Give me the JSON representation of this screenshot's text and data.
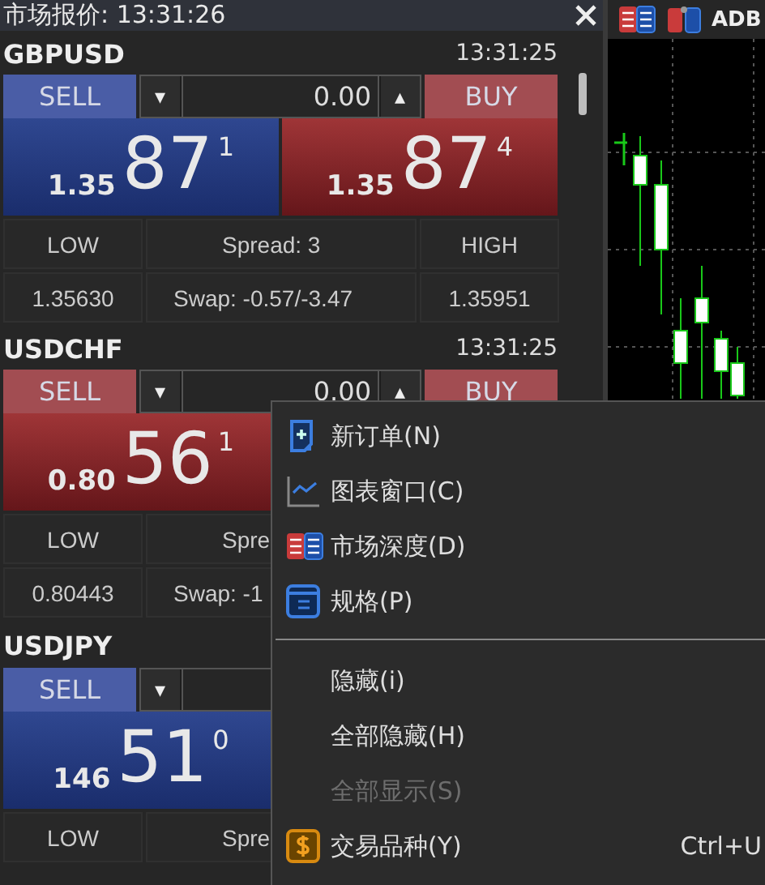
{
  "window": {
    "title": "市场报价: 13:31:26"
  },
  "symbols": [
    {
      "name": "GBPUSD",
      "time": "13:31:25",
      "sell": {
        "label": "SELL",
        "rising": true,
        "prefix": "1.35",
        "big": "87",
        "sup": "1"
      },
      "lot": {
        "down": "▾",
        "value": "0.00",
        "up": "▴"
      },
      "buy": {
        "label": "BUY",
        "rising": false,
        "prefix": "1.35",
        "big": "87",
        "sup": "4"
      },
      "stats": {
        "low_label": "LOW",
        "spread": "Spread: 3",
        "high_label": "HIGH",
        "low": "1.35630",
        "swap": "Swap: -0.57/-3.47",
        "high": "1.35951"
      }
    },
    {
      "name": "USDCHF",
      "time": "13:31:25",
      "sell": {
        "label": "SELL",
        "rising": false,
        "prefix": "0.80",
        "big": "56",
        "sup": "1"
      },
      "lot": {
        "down": "▾",
        "value": "0.00",
        "up": "▴"
      },
      "buy": {
        "label": "BUY",
        "rising": false
      },
      "stats": {
        "low_label": "LOW",
        "spread": "Spre",
        "low": "0.80443",
        "swap": "Swap: -1"
      }
    },
    {
      "name": "USDJPY",
      "sell": {
        "label": "SELL",
        "rising": true,
        "prefix": "146",
        "big": "51",
        "sup": "0"
      },
      "lot": {
        "down": "▾"
      },
      "stats": {
        "low_label": "LOW",
        "spread": "Spre"
      }
    }
  ],
  "chart": {
    "toolbar_text": "ADB"
  },
  "context_menu": [
    {
      "kind": "item",
      "label": "新订单(N)",
      "disabled": false
    },
    {
      "kind": "item",
      "label": "图表窗口(C)",
      "disabled": false
    },
    {
      "kind": "item",
      "label": "市场深度(D)",
      "disabled": false
    },
    {
      "kind": "item",
      "label": "规格(P)",
      "disabled": false
    },
    {
      "kind": "separator"
    },
    {
      "kind": "item",
      "label": "隐藏(i)",
      "disabled": false
    },
    {
      "kind": "item",
      "label": "全部隐藏(H)",
      "disabled": false
    },
    {
      "kind": "item",
      "label": "全部显示(S)",
      "disabled": true
    },
    {
      "kind": "item",
      "label": "交易品种(Y)",
      "shortcut": "Ctrl+U",
      "disabled": false
    }
  ]
}
